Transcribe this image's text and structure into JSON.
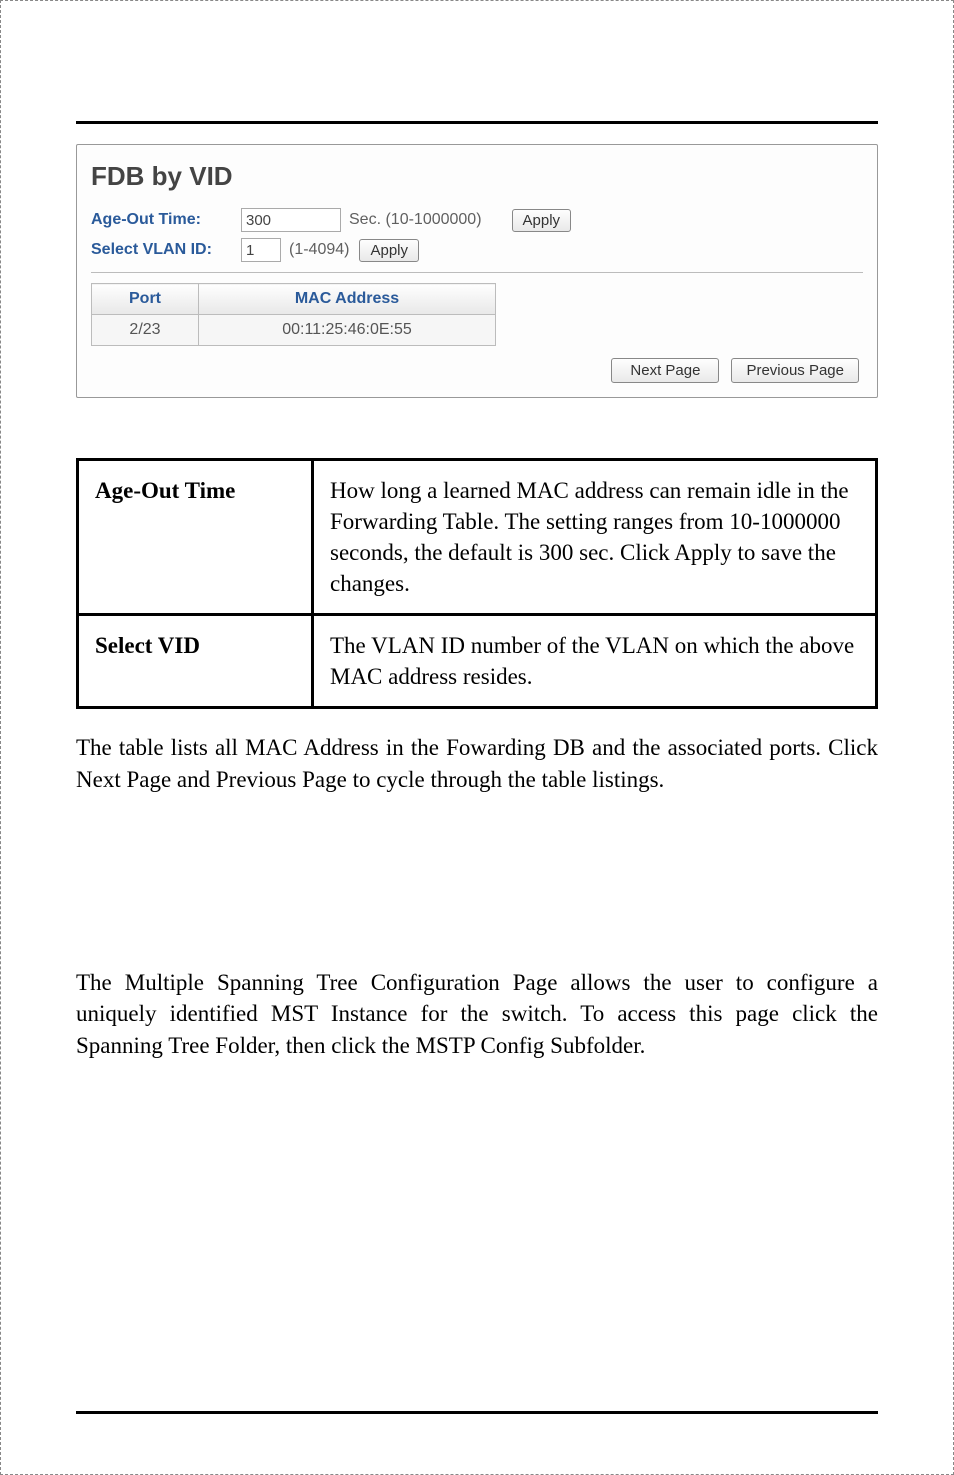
{
  "embedded": {
    "title": "FDB by VID",
    "ageOut": {
      "label": "Age-Out Time:",
      "value": "300",
      "suffix": "Sec. (10-1000000)",
      "apply": "Apply"
    },
    "vlan": {
      "label": "Select VLAN ID:",
      "value": "1",
      "suffix": "(1-4094)",
      "apply": "Apply"
    },
    "table": {
      "headers": {
        "port": "Port",
        "mac": "MAC Address"
      },
      "rows": [
        {
          "port": "2/23",
          "mac": "00:11:25:46:0E:55"
        }
      ]
    },
    "pager": {
      "next": "Next Page",
      "prev": "Previous Page"
    }
  },
  "definitions": [
    {
      "term": "Age-Out Time",
      "desc": "How long a learned MAC address can remain idle in the Forwarding Table. The setting ranges from 10-1000000 seconds, the default is 300 sec. Click Apply to save the changes."
    },
    {
      "term": "Select VID",
      "desc": "The VLAN ID number of the VLAN on which the above MAC address resides."
    }
  ],
  "para1": "The table lists all MAC Address in the Fowarding DB and the associated ports. Click Next Page and Previous Page to cycle through the table listings.",
  "para2": "The Multiple Spanning Tree Configuration Page allows the user to configure a uniquely identified MST Instance for the switch.  To access this page click the Spanning Tree Folder, then click the MSTP Config Subfolder."
}
